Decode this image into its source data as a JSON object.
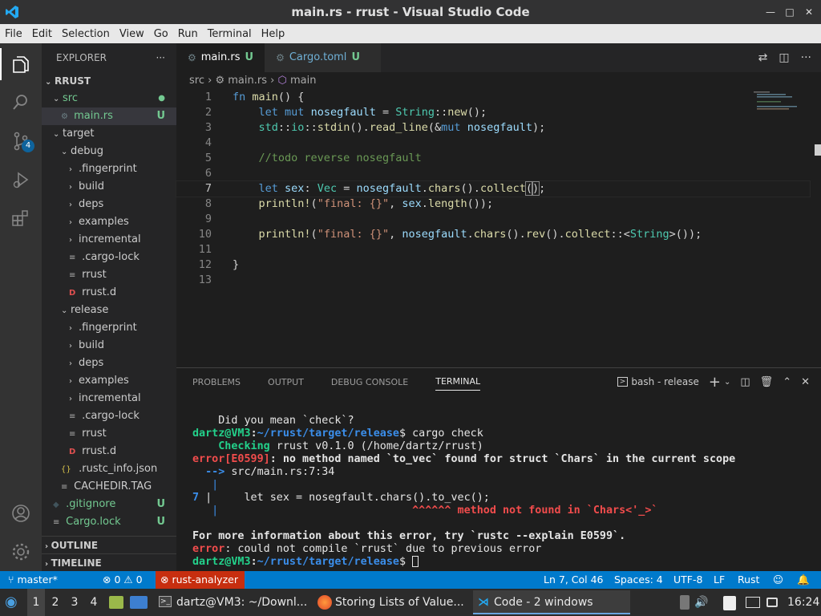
{
  "window": {
    "title": "main.rs - rrust - Visual Studio Code",
    "buttons": [
      "minimize",
      "maximize",
      "close"
    ]
  },
  "menu": [
    "File",
    "Edit",
    "Selection",
    "View",
    "Go",
    "Run",
    "Terminal",
    "Help"
  ],
  "activity": {
    "scm_badge": "4"
  },
  "explorer": {
    "header": "EXPLORER",
    "root": "RRUST",
    "items": [
      {
        "label": "src",
        "indent": 1,
        "chev": "down",
        "status": "dot"
      },
      {
        "label": "main.rs",
        "indent": 2,
        "icon": "rust",
        "status": "U",
        "selected": true
      },
      {
        "label": "target",
        "indent": 1,
        "chev": "down"
      },
      {
        "label": "debug",
        "indent": 2,
        "chev": "down"
      },
      {
        "label": ".fingerprint",
        "indent": 3,
        "chev": "right"
      },
      {
        "label": "build",
        "indent": 3,
        "chev": "right"
      },
      {
        "label": "deps",
        "indent": 3,
        "chev": "right"
      },
      {
        "label": "examples",
        "indent": 3,
        "chev": "right"
      },
      {
        "label": "incremental",
        "indent": 3,
        "chev": "right"
      },
      {
        "label": ".cargo-lock",
        "indent": 3,
        "icon": "lines"
      },
      {
        "label": "rrust",
        "indent": 3,
        "icon": "lines"
      },
      {
        "label": "rrust.d",
        "indent": 3,
        "icon": "d"
      },
      {
        "label": "release",
        "indent": 2,
        "chev": "down"
      },
      {
        "label": ".fingerprint",
        "indent": 3,
        "chev": "right"
      },
      {
        "label": "build",
        "indent": 3,
        "chev": "right"
      },
      {
        "label": "deps",
        "indent": 3,
        "chev": "right"
      },
      {
        "label": "examples",
        "indent": 3,
        "chev": "right"
      },
      {
        "label": "incremental",
        "indent": 3,
        "chev": "right"
      },
      {
        "label": ".cargo-lock",
        "indent": 3,
        "icon": "lines"
      },
      {
        "label": "rrust",
        "indent": 3,
        "icon": "lines"
      },
      {
        "label": "rrust.d",
        "indent": 3,
        "icon": "d"
      },
      {
        "label": ".rustc_info.json",
        "indent": 2,
        "icon": "json"
      },
      {
        "label": "CACHEDIR.TAG",
        "indent": 2,
        "icon": "lines"
      },
      {
        "label": ".gitignore",
        "indent": 1,
        "icon": "git",
        "status": "U"
      },
      {
        "label": "Cargo.lock",
        "indent": 1,
        "icon": "lines",
        "status": "U"
      }
    ],
    "outline": "OUTLINE",
    "timeline": "TIMELINE"
  },
  "tabs": [
    {
      "label": "main.rs",
      "status": "U",
      "active": true
    },
    {
      "label": "Cargo.toml",
      "status": "U",
      "active": false
    }
  ],
  "breadcrumb": {
    "folder": "src",
    "file": "main.rs",
    "symbol": "main"
  },
  "code_lines": [
    "1",
    "2",
    "3",
    "4",
    "5",
    "6",
    "7",
    "8",
    "9",
    "10",
    "11",
    "12",
    "13"
  ],
  "panel": {
    "tabs": [
      "PROBLEMS",
      "OUTPUT",
      "DEBUG CONSOLE",
      "TERMINAL"
    ],
    "active_tab": "TERMINAL",
    "terminal_name": "bash - release"
  },
  "terminal": {
    "l1": "    Did you mean `check`?",
    "prompt": "dartz@VM3",
    "path": "~/rrust/target/release",
    "cmd": "$ cargo check",
    "checking": "    Checking",
    "checking_rest": " rrust v0.1.0 (/home/dartz/rrust)",
    "error_code": "error[E0599]",
    "error_msg": ": no method named `to_vec` found for struct `Chars` in the current scope",
    "arrow": "  -->",
    "loc": " src/main.rs:7:34",
    "bar1": "   |",
    "linenum": "7",
    "code": " |     let sex = nosegfault.chars().to_vec();",
    "bar2": "   |",
    "carets": "                              ^^^^^^ method not found in `Chars<'_>`",
    "blank": "",
    "info": "For more information about this error, try `rustc --explain E0599`.",
    "err2": "error",
    "err2_msg": ": could not compile `rrust` due to previous error",
    "path2": "~/rrust/target/release",
    "prompt2_tail": "$ "
  },
  "status": {
    "branch": "master*",
    "errors": "0",
    "warnings": "0",
    "analyzer": "rust-analyzer",
    "position": "Ln 7, Col 46",
    "spaces": "Spaces: 4",
    "encoding": "UTF-8",
    "eol": "LF",
    "language": "Rust"
  },
  "taskbar": {
    "workspaces": [
      "1",
      "2",
      "3",
      "4"
    ],
    "tasks": [
      "dartz@VM3: ~/Downl...",
      "Storing Lists of Value...",
      "Code - 2 windows"
    ],
    "clock": "16:24"
  }
}
